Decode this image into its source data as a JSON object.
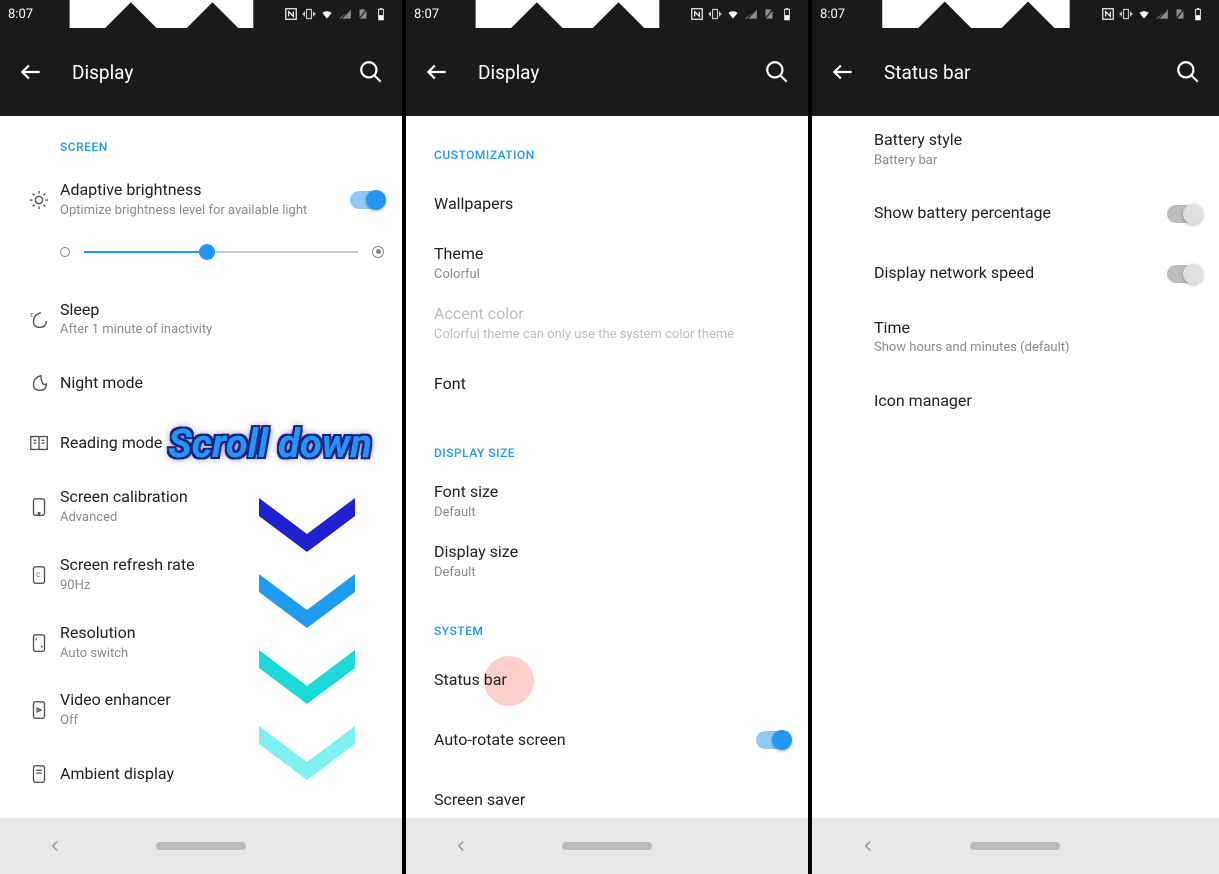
{
  "status": {
    "time": "8:07"
  },
  "panel1": {
    "title": "Display",
    "section_screen": "SCREEN",
    "adaptive": {
      "title": "Adaptive brightness",
      "sub": "Optimize brightness level for available light"
    },
    "sleep": {
      "title": "Sleep",
      "sub": "After 1 minute of inactivity"
    },
    "night": {
      "title": "Night mode"
    },
    "reading": {
      "title": "Reading mode"
    },
    "calibration": {
      "title": "Screen calibration",
      "sub": "Advanced"
    },
    "refresh": {
      "title": "Screen refresh rate",
      "sub": "90Hz"
    },
    "resolution": {
      "title": "Resolution",
      "sub": "Auto switch"
    },
    "video": {
      "title": "Video enhancer",
      "sub": "Off"
    },
    "ambient": {
      "title": "Ambient display"
    },
    "overlay": "Scroll down"
  },
  "panel2": {
    "title": "Display",
    "section_customization": "CUSTOMIZATION",
    "wallpapers": {
      "title": "Wallpapers"
    },
    "theme": {
      "title": "Theme",
      "sub": "Colorful"
    },
    "accent": {
      "title": "Accent color",
      "sub": "Colorful theme can only use the system color theme"
    },
    "font": {
      "title": "Font"
    },
    "section_displaysize": "DISPLAY SIZE",
    "fontsize": {
      "title": "Font size",
      "sub": "Default"
    },
    "displaysize": {
      "title": "Display size",
      "sub": "Default"
    },
    "section_system": "SYSTEM",
    "statusbar": {
      "title": "Status bar"
    },
    "autorotate": {
      "title": "Auto-rotate screen"
    },
    "screensaver": {
      "title": "Screen saver"
    }
  },
  "panel3": {
    "title": "Status bar",
    "battery": {
      "title": "Battery style",
      "sub": "Battery bar"
    },
    "percentage": {
      "title": "Show battery percentage"
    },
    "network": {
      "title": "Display network speed"
    },
    "time": {
      "title": "Time",
      "sub": "Show hours and minutes (default)"
    },
    "iconmgr": {
      "title": "Icon manager"
    }
  }
}
